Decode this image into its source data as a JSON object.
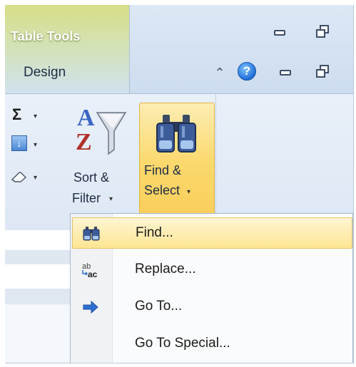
{
  "contextual_tab": {
    "group_label": "Table Tools",
    "tab_label": "Design"
  },
  "window_controls": {
    "top_row": [
      "minimize-icon",
      "restore-icon"
    ],
    "tab_row": [
      "ribbon-collapse-icon",
      "help-icon",
      "minimize-icon",
      "restore-icon"
    ],
    "help_glyph": "?",
    "collapse_glyph": "⌃"
  },
  "ribbon": {
    "autosum_glyph": "Σ",
    "fill_glyph": "↓",
    "sort_filter": {
      "line1": "Sort &",
      "line2": "Filter",
      "letters_top": "A",
      "letters_bottom": "Z"
    },
    "find_select": {
      "line1": "Find &",
      "line2": "Select"
    },
    "dropdown_glyph": "▾"
  },
  "menu": {
    "items": [
      {
        "label": "Find...",
        "icon": "binoculars-icon",
        "highlighted": true
      },
      {
        "label": "Replace...",
        "icon": "replace-icon",
        "highlighted": false
      },
      {
        "label": "Go To...",
        "icon": "arrow-right-icon",
        "highlighted": false
      },
      {
        "label": "Go To Special...",
        "icon": "",
        "highlighted": false
      }
    ],
    "replace_icon_text": {
      "top": "ab",
      "bottom": "ac"
    }
  },
  "colors": {
    "highlight": "#fde593",
    "highlight_border": "#e5c26a",
    "ribbon": "#dde7f4",
    "contextual_tab": "#d8dd86",
    "help_blue": "#1f6fd6",
    "arrow_blue": "#2c6fd1"
  }
}
